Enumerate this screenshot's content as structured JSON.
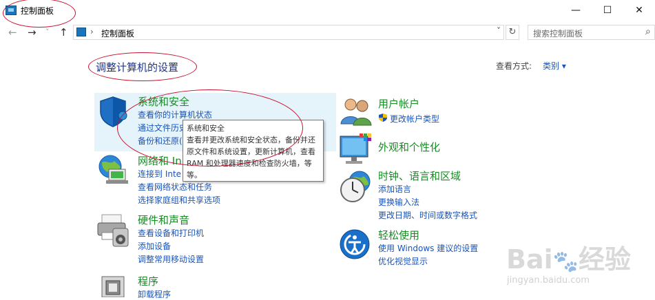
{
  "window": {
    "title": "控制面板",
    "minimize_glyph": "—",
    "maximize_glyph": "☐",
    "close_glyph": "✕"
  },
  "nav": {
    "back_glyph": "←",
    "forward_glyph": "→",
    "recent_glyph": "˅",
    "up_glyph": "↑",
    "address_sep": "›",
    "address": "控制面板",
    "address_dropdown_glyph": "˅",
    "refresh_glyph": "↻",
    "search_placeholder": "搜索控制面板",
    "search_glyph": "⌕"
  },
  "main": {
    "heading": "调整计算机的设置",
    "view_by_label": "查看方式:",
    "view_by_value": "类别 ▾"
  },
  "categories_left": [
    {
      "title": "系统和安全",
      "links": [
        "查看你的计算机状态",
        "通过文件历史",
        "备份和还原("
      ]
    },
    {
      "title": "网络和 In",
      "links": [
        "连接到 Inte",
        "查看网络状态和任务",
        "选择家庭组和共享选项"
      ]
    },
    {
      "title": "硬件和声音",
      "links": [
        "查看设备和打印机",
        "添加设备",
        "调整常用移动设置"
      ]
    },
    {
      "title": "程序",
      "links": [
        "卸载程序"
      ]
    }
  ],
  "categories_right": [
    {
      "title": "用户帐户",
      "links": [
        "更改帐户类型"
      ]
    },
    {
      "title": "外观和个性化",
      "links": []
    },
    {
      "title": "时钟、语言和区域",
      "links": [
        "添加语言",
        "更换输入法",
        "更改日期、时间或数字格式"
      ]
    },
    {
      "title": "轻松使用",
      "links": [
        "使用 Windows 建议的设置",
        "优化视觉显示"
      ]
    }
  ],
  "tooltip": {
    "title": "系统和安全",
    "body": "查看并更改系统和安全状态，备份并还原文件和系统设置，更新计算机，查看 RAM 和处理器速度和检查防火墙，等等。"
  },
  "watermark": {
    "brand": "Bai",
    "paw": "🐾",
    "brand_suffix": "经验",
    "url": "jingyan.baidu.com"
  },
  "colors": {
    "category_title": "#178c23",
    "link": "#1a54b8",
    "heading": "#1e3287",
    "annotation": "#c8102e"
  }
}
